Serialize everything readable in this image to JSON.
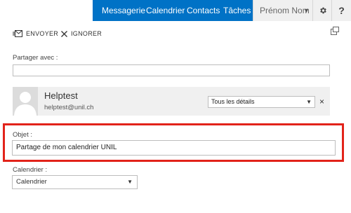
{
  "nav": {
    "items": [
      "Messagerie",
      "Calendrier",
      "Contacts",
      "Tâches"
    ],
    "user_name": "Prénom Nom",
    "help_label": "?"
  },
  "toolbar": {
    "send_label": "ENVOYER",
    "discard_label": "IGNORER"
  },
  "share": {
    "share_with_label": "Partager avec :",
    "share_with_value": ""
  },
  "recipient": {
    "name": "Helptest",
    "email": "helptest@unil.ch",
    "permission": "Tous les détails",
    "remove_label": "×"
  },
  "subject": {
    "label": "Objet :",
    "value": "Partage de mon calendrier UNIL"
  },
  "calendar": {
    "label": "Calendrier :",
    "value": "Calendrier"
  },
  "colors": {
    "nav_blue": "#0072c6",
    "highlight_red": "#e2231a"
  },
  "icons": [
    "send-icon",
    "discard-icon",
    "popout-icon",
    "gear-icon",
    "avatar-placeholder-icon",
    "chevron-down-icon"
  ]
}
